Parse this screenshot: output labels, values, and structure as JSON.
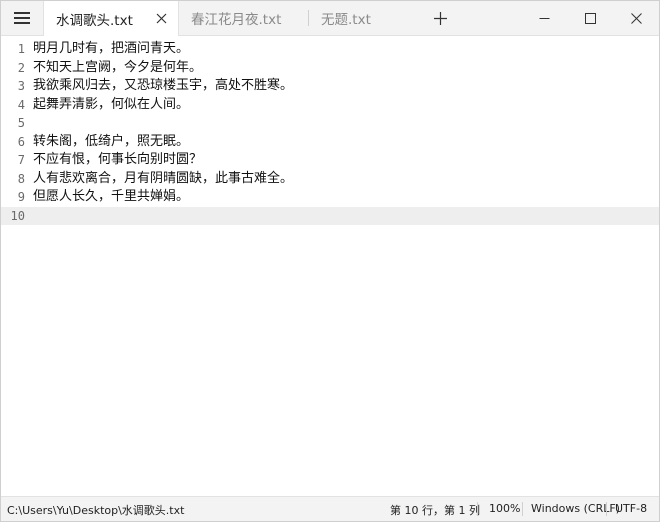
{
  "tabs": [
    {
      "label": "水调歌头.txt",
      "active": true
    },
    {
      "label": "春江花月夜.txt",
      "active": false
    },
    {
      "label": "无题.txt",
      "active": false
    }
  ],
  "icons": {
    "menu": "hamburger-icon",
    "close_tab": "close-icon",
    "new_tab": "plus-icon",
    "minimize": "minimize-icon",
    "maximize": "maximize-icon",
    "close_window": "close-icon"
  },
  "editor": {
    "current_line": 10,
    "lines": [
      {
        "num": "1",
        "text": "明月几时有，把酒问青天。"
      },
      {
        "num": "2",
        "text": "不知天上宫阙，今夕是何年。"
      },
      {
        "num": "3",
        "text": "我欲乘风归去，又恐琼楼玉宇，高处不胜寒。"
      },
      {
        "num": "4",
        "text": "起舞弄清影，何似在人间。"
      },
      {
        "num": "5",
        "text": ""
      },
      {
        "num": "6",
        "text": "转朱阁，低绮户，照无眠。"
      },
      {
        "num": "7",
        "text": "不应有恨，何事长向别时圆？"
      },
      {
        "num": "8",
        "text": "人有悲欢离合，月有阴晴圆缺，此事古难全。"
      },
      {
        "num": "9",
        "text": "但愿人长久，千里共婵娟。"
      },
      {
        "num": "10",
        "text": ""
      }
    ]
  },
  "status": {
    "path": "C:\\Users\\Yu\\Desktop\\水调歌头.txt",
    "position": "第 10 行，第 1 列",
    "zoom": "100%",
    "eol": "Windows (CRLF)",
    "encoding": "UTF-8"
  },
  "colors": {
    "tabbar_bg": "#f3f3f3",
    "active_tab_bg": "#ffffff",
    "current_line_bg": "#eeeeee",
    "line_number": "#6a6a6a",
    "inactive_tab_text": "#8a8a8a"
  }
}
